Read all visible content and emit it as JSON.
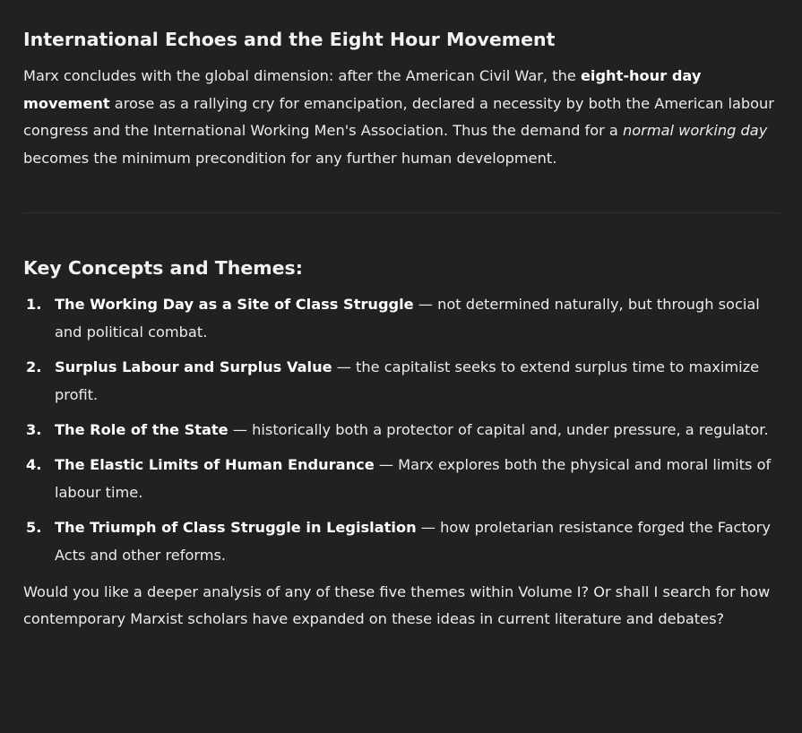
{
  "section1": {
    "heading": "International Echoes and the Eight Hour Movement",
    "p_1": "Marx concludes with the global dimension: after the American Civil War, the ",
    "p_bold": "eight-hour day movement",
    "p_2": " arose as a rallying cry for emancipation, declared a necessity by both the American labour congress and the International Working Men's Association. Thus the demand for a ",
    "p_italic": "normal working day",
    "p_3": " becomes the minimum precondition for any further human development."
  },
  "section2": {
    "heading": "Key Concepts and Themes:",
    "items": [
      {
        "num": "1.",
        "title": "The Working Day as a Site of Class Struggle",
        "desc": " — not determined naturally, but through social and political combat."
      },
      {
        "num": "2.",
        "title": "Surplus Labour and Surplus Value",
        "desc": " — the capitalist seeks to extend surplus time to maximize profit."
      },
      {
        "num": "3.",
        "title": "The Role of the State",
        "desc": " — historically both a protector of capital and, under pressure, a regulator."
      },
      {
        "num": "4.",
        "title": "The Elastic Limits of Human Endurance",
        "desc": " — Marx explores both the physical and moral limits of labour time."
      },
      {
        "num": "5.",
        "title": "The Triumph of Class Struggle in Legislation",
        "desc": " — how proletarian resistance forged the Factory Acts and other reforms."
      }
    ]
  },
  "closing": "Would you like a deeper analysis of any of these five themes within Volume I? Or shall I search for how contemporary Marxist scholars have expanded on these ideas in current literature and debates?"
}
